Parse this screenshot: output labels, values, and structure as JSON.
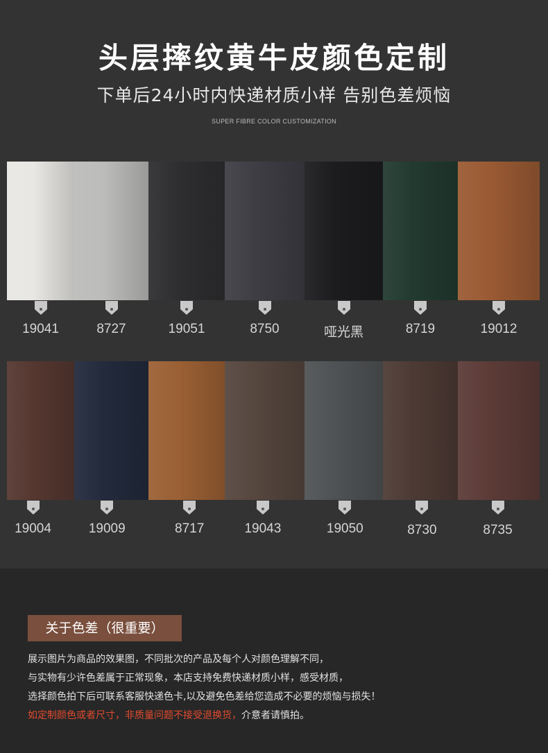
{
  "header": {
    "title": "头层摔纹黄牛皮颜色定制",
    "subtitle": "下单后24小时内快递材质小样  告别色差烦恼",
    "english_tag": "SUPER FIBRE COLOR CUSTOMIZATION"
  },
  "swatches_row1": [
    {
      "code": "19041",
      "color": "#e8e7e4"
    },
    {
      "code": "8727",
      "color": "#bcbcba"
    },
    {
      "code": "19051",
      "color": "#2e2e30"
    },
    {
      "code": "8750",
      "color": "#3e3d44"
    },
    {
      "code": "哑光黑",
      "color": "#1c1c1f"
    },
    {
      "code": "8719",
      "color": "#223a30"
    },
    {
      "code": "19012",
      "color": "#9a5a33"
    }
  ],
  "swatches_row2": [
    {
      "code": "19004",
      "color": "#553730"
    },
    {
      "code": "19009",
      "color": "#222a3c"
    },
    {
      "code": "8717",
      "color": "#9b6034"
    },
    {
      "code": "19043",
      "color": "#55463e"
    },
    {
      "code": "19050",
      "color": "#4f5254"
    },
    {
      "code": "8730",
      "color": "#4d3a34"
    },
    {
      "code": "8735",
      "color": "#5c3b37"
    }
  ],
  "notice": {
    "badge": "关于色差（很重要）",
    "line1": "展示图片为商品的效果图，不同批次的产品及每个人对颜色理解不同，",
    "line2": "与实物有少许色差属于正常现象，本店支持免费快递材质小样，感受材质，",
    "line3": "选择颜色拍下后可联系客服快递色卡,以及避免色差给您造成不必要的烦恼与损失！",
    "line4_red": "如定制颜色或者尺寸，非质量问题不接受退换货，",
    "line4_rest": "介意者请慎拍。"
  },
  "colors": {
    "accent_red": "#e04a2f",
    "badge_bg": "#7a4f3d"
  }
}
